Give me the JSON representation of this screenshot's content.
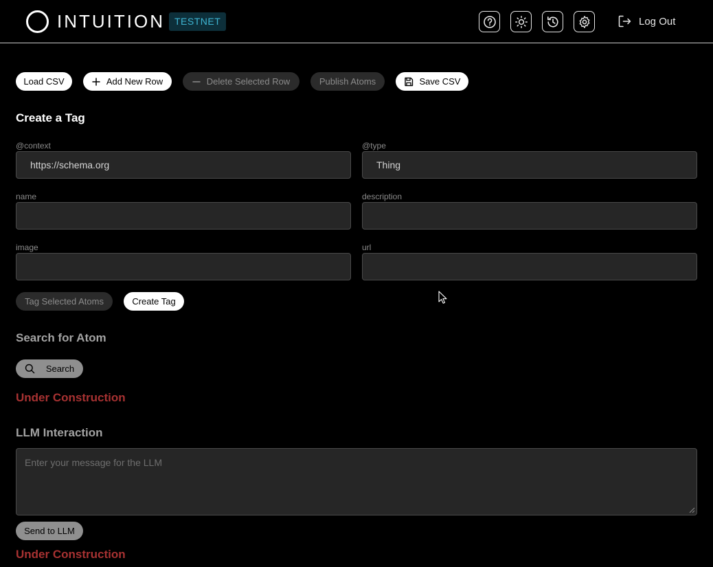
{
  "header": {
    "logo_text": "INTUITION",
    "network_badge": "TESTNET",
    "icons": [
      "help-icon",
      "theme-sun-icon",
      "history-icon",
      "settings-gear-icon"
    ],
    "logout_label": "Log Out"
  },
  "toolbar": {
    "load_csv": "Load CSV",
    "add_row": "Add New Row",
    "delete_row": "Delete Selected Row",
    "publish_atoms": "Publish Atoms",
    "save_csv": "Save CSV"
  },
  "create_tag": {
    "title": "Create a Tag",
    "fields": {
      "context": {
        "label": "@context",
        "value": "https://schema.org"
      },
      "type": {
        "label": "@type",
        "value": "Thing"
      },
      "name": {
        "label": "name",
        "value": ""
      },
      "description": {
        "label": "description",
        "value": ""
      },
      "image": {
        "label": "image",
        "value": ""
      },
      "url": {
        "label": "url",
        "value": ""
      }
    },
    "tag_selected": "Tag Selected Atoms",
    "create_tag": "Create Tag"
  },
  "search": {
    "title": "Search for Atom",
    "button": "Search",
    "status": "Under Construction"
  },
  "llm": {
    "title": "LLM Interaction",
    "placeholder": "Enter your message for the LLM",
    "send": "Send to LLM",
    "status": "Under Construction"
  },
  "colors": {
    "background": "#000000",
    "badge_text": "#3fb6d4",
    "warning_red": "#a83232",
    "field_bg": "#262626"
  }
}
